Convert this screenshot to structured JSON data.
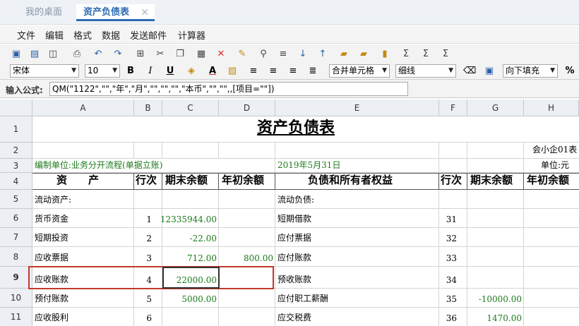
{
  "tabs": [
    {
      "label": "我的桌面"
    },
    {
      "label": "资产负债表"
    }
  ],
  "tab_close": "✕",
  "menu": [
    "文件",
    "编辑",
    "格式",
    "数据",
    "发送邮件",
    "计算器"
  ],
  "toolbar": {
    "font_name": "宋体",
    "font_size": "10",
    "bold": "B",
    "italic": "I",
    "underline": "U",
    "font_color": "A",
    "merge_select": "合并单元格",
    "line_select": "细线",
    "fill_select": "向下填充",
    "percent": "%"
  },
  "formula_bar": {
    "label": "输入公式:",
    "value": "QM(\"1122\",\"\",\"年\",\"月\",\"\",\"\",\"\",\"本币\",\"\",\"\",,[项目=\"\"])"
  },
  "columns": [
    "A",
    "B",
    "C",
    "D",
    "E",
    "F",
    "G",
    "H"
  ],
  "rows": [
    "1",
    "2",
    "3",
    "4",
    "5",
    "6",
    "7",
    "8",
    "9",
    "10",
    "11"
  ],
  "sheet": {
    "title": "资产负债表",
    "form_no": "会小企01表",
    "unit_label": "编制单位:业务分开流程(单据立账)",
    "date": "2019年5月31日",
    "currency_unit": "单位:元",
    "headers": [
      "资　　产",
      "行次",
      "期末余额",
      "年初余额",
      "负债和所有者权益",
      "行次",
      "期末余额",
      "年初余额"
    ],
    "section_left": "流动资产:",
    "section_right": "流动负债:",
    "lines": [
      {
        "asset": "货币资金",
        "no": "1",
        "end": "12335944.00",
        "begin": "",
        "liab": "短期借款",
        "lno": "31",
        "lend": "",
        "lbegin": ""
      },
      {
        "asset": "短期投资",
        "no": "2",
        "end": "-22.00",
        "begin": "",
        "liab": "应付票据",
        "lno": "32",
        "lend": "",
        "lbegin": ""
      },
      {
        "asset": "应收票据",
        "no": "3",
        "end": "712.00",
        "begin": "800.00",
        "liab": "应付账款",
        "lno": "33",
        "lend": "",
        "lbegin": ""
      },
      {
        "asset": "应收账款",
        "no": "4",
        "end": "22000.00",
        "begin": "",
        "liab": "预收账款",
        "lno": "34",
        "lend": "",
        "lbegin": ""
      },
      {
        "asset": "预付账款",
        "no": "5",
        "end": "5000.00",
        "begin": "",
        "liab": "应付职工薪酬",
        "lno": "35",
        "lend": "-10000.00",
        "lbegin": ""
      },
      {
        "asset": "应收股利",
        "no": "6",
        "end": "",
        "begin": "",
        "liab": "应交税费",
        "lno": "36",
        "lend": "1470.00",
        "lbegin": ""
      }
    ]
  }
}
